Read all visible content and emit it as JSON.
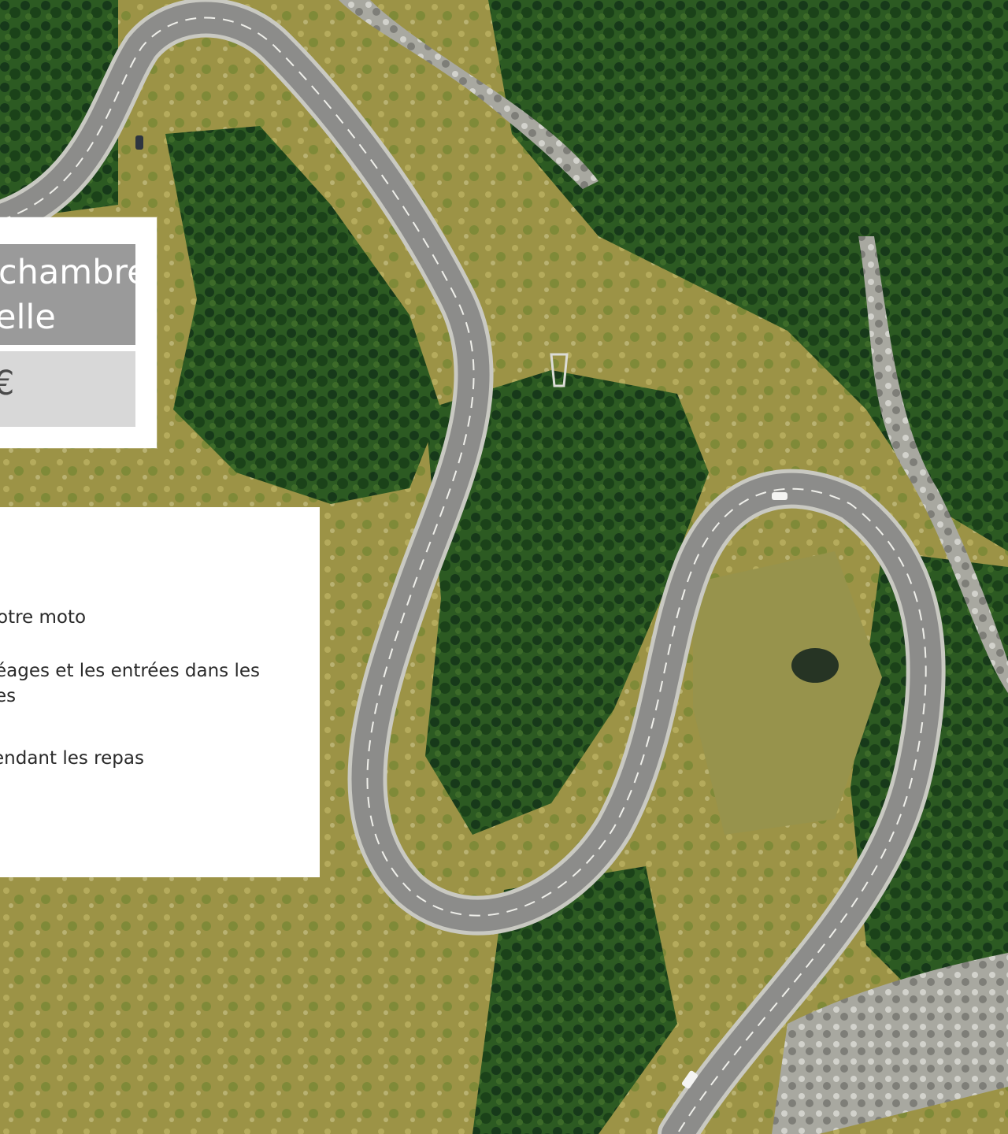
{
  "price_card": {
    "room_type_line1": "chambre",
    "room_type_line2": "elle",
    "price": "€"
  },
  "includes": {
    "items": [
      {
        "line1": "otre moto",
        "line2": ""
      },
      {
        "line1": "éages et les entrées dans les",
        "line2": "es"
      },
      {
        "line1": "endant les repas",
        "line2": ""
      }
    ]
  },
  "colors": {
    "room_type_bg": "#9a9a9a",
    "price_bg": "#d8d8d8",
    "card_bg": "#ffffff",
    "road": "#8c8c8a",
    "forest": "#1f4a1a",
    "meadow": "#a4a04a"
  }
}
